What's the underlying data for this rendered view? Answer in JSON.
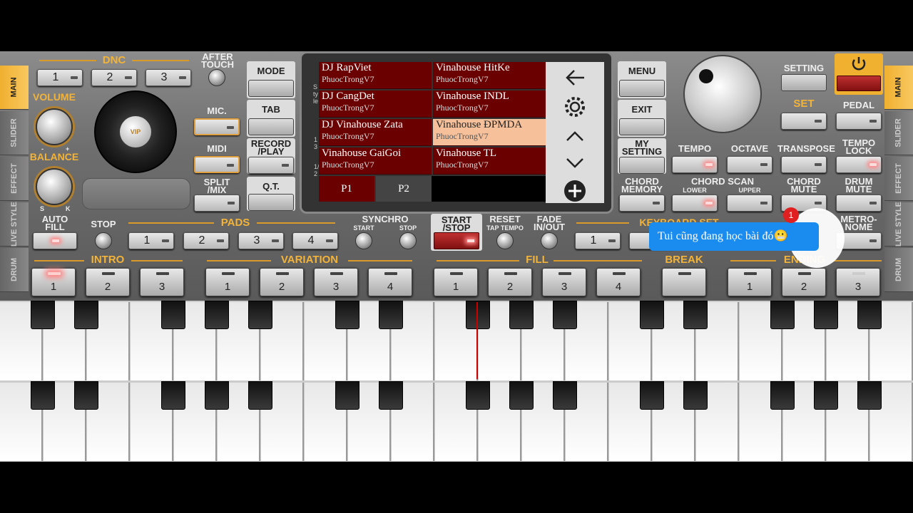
{
  "side_tabs_left": [
    "MAIN",
    "SLIDER",
    "EFFECT",
    "LIVE STYLE",
    "DRUM"
  ],
  "side_tabs_right": [
    "MAIN",
    "SLIDER",
    "EFFECT",
    "LIVE STYLE",
    "DRUM"
  ],
  "dnc": {
    "title": "DNC",
    "buttons": [
      "1",
      "2",
      "3"
    ],
    "after_touch": "AFTER TOUCH"
  },
  "volume_label": "VOLUME",
  "balance_label": "BALANCE",
  "balance_marks": {
    "minus": "-",
    "plus": "+",
    "s": "S",
    "k": "K"
  },
  "vip_label": "VIP",
  "left_buttons": {
    "mic": "MIC.",
    "midi": "MIDI",
    "split_mix": "SPLIT /MIX"
  },
  "mode_col": {
    "mode": "MODE",
    "tab": "TAB",
    "record_play": "RECORD /PLAY",
    "qt": "Q.T."
  },
  "screen": {
    "side_label_top": "Style",
    "side_label_mid": "13",
    "side_label_bot": "1/2",
    "styles": [
      {
        "title": "DJ RapViet",
        "sub": "PhuocTrongV7"
      },
      {
        "title": "Vinahouse HitKe",
        "sub": "PhuocTrongV7"
      },
      {
        "title": "DJ CangDet",
        "sub": "PhuocTrongV7"
      },
      {
        "title": "Vinahouse INDL",
        "sub": "PhuocTrongV7"
      },
      {
        "title": "DJ Vinahouse Zata",
        "sub": "PhuocTrongV7"
      },
      {
        "title": "Vinahouse ĐPMDA",
        "sub": "PhuocTrongV7"
      },
      {
        "title": "Vinahouse GaiGoi",
        "sub": "PhuocTrongV7"
      },
      {
        "title": "Vinahouse TL",
        "sub": "PhuocTrongV7"
      }
    ],
    "pages": [
      "P1",
      "P2"
    ],
    "icons": [
      "back-arrow-icon",
      "gear-icon",
      "chevron-up-icon",
      "chevron-down-icon",
      "plus-circle-icon"
    ]
  },
  "menu_col": {
    "menu": "MENU",
    "exit": "EXIT",
    "my_setting": "MY SETTING",
    "chord_memory": "CHORD MEMORY"
  },
  "right_panel": {
    "setting": "SETTING",
    "set": "SET",
    "pedal": "PEDAL",
    "tempo": "TEMPO",
    "octave": "OCTAVE",
    "transpose": "TRANSPOSE",
    "tempo_lock": "TEMPO LOCK",
    "chord_scan": "CHORD SCAN",
    "lower": "LOWER",
    "upper": "UPPER",
    "chord_mute": "CHORD MUTE",
    "drum_mute": "DRUM MUTE",
    "keyboard_set": "KEYBOARD SET",
    "metronome": "METRO- NOME"
  },
  "middle_row": {
    "auto_fill": "AUTO FILL",
    "stop": "STOP",
    "pads": "PADS",
    "pad_buttons": [
      "1",
      "2",
      "3",
      "4"
    ],
    "synchro": "SYNCHRO",
    "synchro_start": "START",
    "synchro_stop": "STOP",
    "start_stop": "START /STOP",
    "reset": "RESET",
    "tap_tempo": "TAP TEMPO",
    "fade": "FADE IN/OUT",
    "kb_buttons": [
      "1"
    ]
  },
  "bottom_row": {
    "intro": "INTRO",
    "intro_buttons": [
      "1",
      "2",
      "3"
    ],
    "variation": "VARIATION",
    "variation_buttons": [
      "1",
      "2",
      "3",
      "4"
    ],
    "fill": "FILL",
    "fill_buttons": [
      "1",
      "2",
      "3",
      "4"
    ],
    "break": "BREAK",
    "ending": "ENDING",
    "ending_buttons": [
      "1",
      "2",
      "3"
    ]
  },
  "chat_bubble": {
    "text": "Tui cũng đang học bài đó😬",
    "badge": "1"
  }
}
